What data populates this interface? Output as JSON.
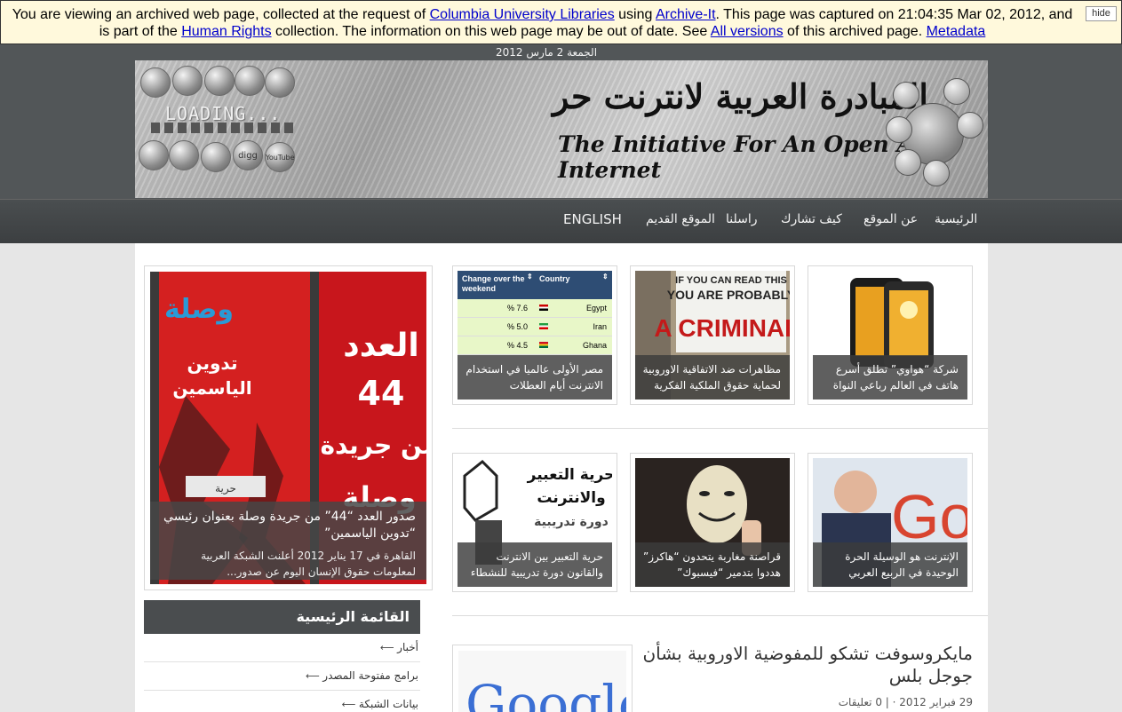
{
  "archive": {
    "text1": "You are viewing an archived web page, collected at the request of ",
    "link_library": "Columbia University Libraries",
    "text2": " using ",
    "link_archiveit": "Archive-It",
    "text3": ". This page was captured on 21:04:35 Mar 02, 2012, and is part of the ",
    "link_collection": "Human Rights",
    "text4": " collection. The information on this web page may be out of date. See ",
    "link_versions": "All versions",
    "text5": " of this archived page. ",
    "link_metadata": "Metadata",
    "hide_label": "hide"
  },
  "header": {
    "date": "الجمعة  2  مارس  2012",
    "banner_title_ar": "المبادرة العربية لانترنت حر",
    "banner_title_en": "The Initiative For An Open Arab Internet",
    "loading_text": "LOADING...",
    "social_labels": [
      "digg",
      "YouTube"
    ]
  },
  "nav": {
    "home": "الرئيسية",
    "about": "عن الموقع",
    "participate": "كيف تشارك",
    "contact": "راسلنا",
    "old_site": "الموقع القديم",
    "english": "ENGLISH"
  },
  "featured": {
    "image_text_issue": "العدد",
    "image_text_number": "44",
    "image_text_from": "من جريدة",
    "image_text_brand": "وصلة",
    "image_text_tadwin": "تدوين",
    "image_text_yasmin": "الياسمين",
    "image_text_hurriya": "حرية",
    "title": "صدور العدد “44” من جريدة وصلة بعنوان رئيسي “تدوين الياسمين”",
    "excerpt": "القاهرة في 17 يناير 2012  أعلنت الشبكة العربية لمعلومات حقوق الإنسان اليوم عن صدور..."
  },
  "cards_row1": [
    {
      "caption": "شركة “هواوي” تطلق أسرع هاتف في العالم رباعي النواة"
    },
    {
      "caption": "مظاهرات ضد الاتفاقية الاوروبية لحماية حقوق الملكية الفكرية",
      "image_sign_line1": "IF YOU CAN READ THIS",
      "image_sign_line2": "YOU ARE PROBABLY",
      "image_sign_line3": "A CRIMINAL!"
    },
    {
      "caption": "مصر الأولى عالميا في استخدام الانترنت أيام العطلات",
      "table_header_change": "Change over the weekend",
      "table_header_country": "Country",
      "rows": [
        {
          "country": "Egypt",
          "change": "% 7.6"
        },
        {
          "country": "Iran",
          "change": "% 5.0"
        },
        {
          "country": "Ghana",
          "change": "% 4.5"
        }
      ]
    }
  ],
  "cards_row2": [
    {
      "caption": "الإنترنت هو الوسيلة الحرة الوحيدة في الربيع العربي",
      "image_word": "Goo"
    },
    {
      "caption": "قراصنة مغاربة يتحدون “هاكرز” هددوا بتدمير “فيسبوك”"
    },
    {
      "caption": "حرية التعبير بين الانترنت والقانون دورة تدريبية للنشطاء",
      "image_title_1": "حرية التعبير",
      "image_title_2": "والانترنت",
      "image_title_3": "دورة تدريبية"
    }
  ],
  "menu": {
    "heading": "القائمة الرئيسية",
    "items": [
      "أخبار",
      "برامج مفتوحة المصدر",
      "بيانات الشبكة"
    ]
  },
  "post": {
    "title": "مايكروسوفت تشكو للمفوضية الاوروبية بشأن جوجل بلس",
    "meta_date": "29  فبراير  2012",
    "meta_sep": " · | ",
    "meta_comments": "0 تعليقات",
    "thumb_word": "Google"
  },
  "colors": {
    "dark_header": "#525658",
    "nav": "#3c3f41",
    "featured_red": "#c01818",
    "archive_bg": "#fff9dc",
    "link": "#0000cc"
  }
}
